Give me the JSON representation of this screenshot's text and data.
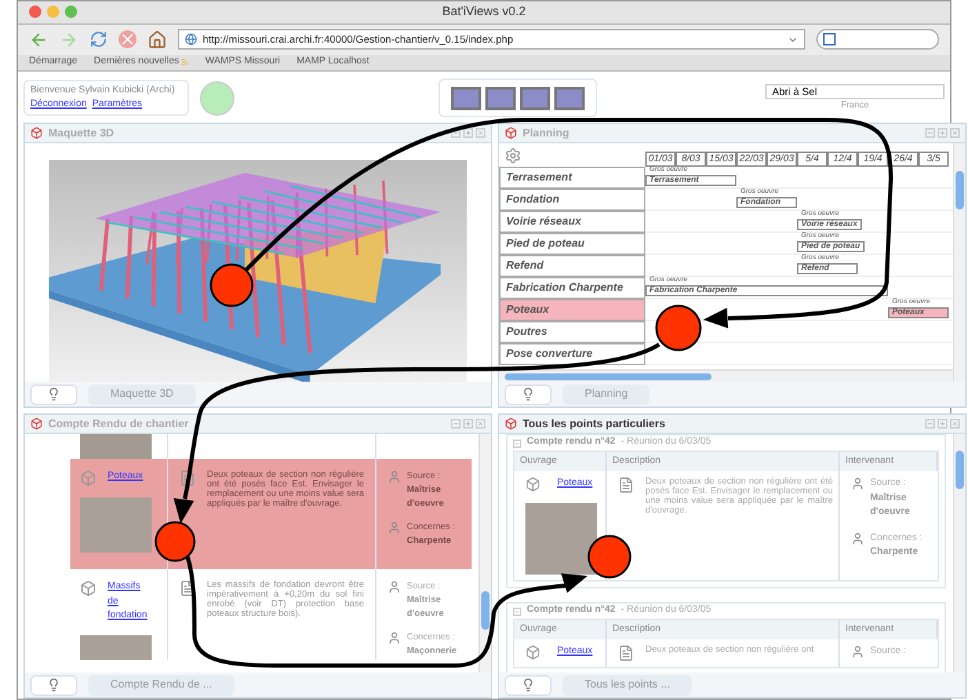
{
  "window": {
    "title": "Bat'iViews v0.2"
  },
  "toolbar": {
    "url": "http://missouri.crai.archi.fr:40000/Gestion-chantier/v_0.15/index.php"
  },
  "bookmarks": [
    {
      "label": "Démarrage",
      "feed": false
    },
    {
      "label": "Dernières nouvelles",
      "feed": true
    },
    {
      "label": "WAMPS Missouri",
      "feed": false
    },
    {
      "label": "MAMP Localhost",
      "feed": false
    }
  ],
  "header": {
    "welcome": "Bienvenue Sylvain Kubicki (Archi)",
    "links": [
      "Déconnexion",
      "Paramètres"
    ],
    "project": "Abri à Sel",
    "country": "France"
  },
  "maquette": {
    "title": "Maquette 3D",
    "tab": "Maquette 3D"
  },
  "planning": {
    "title": "Planning",
    "tab": "Planning",
    "dates": [
      "01/03",
      "8/03",
      "15/03",
      "22/03",
      "29/03",
      "5/4",
      "12/4",
      "19/4",
      "26/4",
      "3/5"
    ],
    "tasks": [
      {
        "label": "Terrasement",
        "selected": false,
        "bar": {
          "group": "Gros oeuvre",
          "label": "Terrasement"
        }
      },
      {
        "label": "Fondation",
        "selected": false,
        "bar": {
          "group": "Gros oeuvre",
          "label": "Fondation"
        }
      },
      {
        "label": "Voirie réseaux",
        "selected": false,
        "bar": {
          "group": "Gros oeuvre",
          "label": "Voirie réseaux"
        }
      },
      {
        "label": "Pied de poteau",
        "selected": false,
        "bar": {
          "group": "Gros oeuvre",
          "label": "Pied de poteau"
        }
      },
      {
        "label": "Refend",
        "selected": false,
        "bar": {
          "group": "Gros oeuvre",
          "label": "Refend"
        }
      },
      {
        "label": "Fabrication Charpente",
        "selected": false,
        "bar": {
          "group": "Gros oeuvre",
          "label": "Fabrication Charpente"
        }
      },
      {
        "label": "Poteaux",
        "selected": true,
        "bar": {
          "group": "Gros oeuvre",
          "label": "Poteaux"
        }
      },
      {
        "label": "Poutres",
        "selected": false
      },
      {
        "label": "Pose converture",
        "selected": false
      }
    ]
  },
  "compte_rendu": {
    "title": "Compte Rendu de chantier",
    "tab": "Compte Rendu de ...",
    "rows": [
      {
        "ouvrage": "Poteaux",
        "description": "Deux poteaux de section non régulière ont été posés face Est. Envisager le remplacement ou une moins value sera appliqués par le maître d'ouvrage.",
        "source_label": "Source :",
        "source": "Maîtrise d'oeuvre",
        "concerne_label": "Concernes :",
        "concerne": "Charpente",
        "selected": true
      },
      {
        "ouvrage": "Massifs de fondation",
        "description": "Les massifs de fondation devront être impérativement à +0,20m du sol fini enrobé (voir DT) protection base poteaux structure bois).",
        "source_label": "Source :",
        "source": "Maîtrise d'oeuvre",
        "concerne_label": "Concernes :",
        "concerne": "Maçonnerie",
        "selected": false
      }
    ]
  },
  "points": {
    "title": "Tous les points particuliers",
    "tab": "Tous les points ...",
    "reports": [
      {
        "heading": "Compte rendu n°42",
        "meeting": "- Réunion du 6/03/05",
        "columns": [
          "Ouvrage",
          "Description",
          "Intervenant"
        ],
        "ouvrage": "Poteaux",
        "description": "Deux poteaux de section non régulière ont été posés face Est. Envisager le remplacement ou une moins value sera appliquée par le maître d'ouvrage.",
        "source_label": "Source :",
        "source": "Maîtrise d'oeuvre",
        "concerne_label": "Concernes :",
        "concerne": "Charpente"
      },
      {
        "heading": "Compte rendu n°42",
        "meeting": "- Réunion du 6/03/05",
        "columns": [
          "Ouvrage",
          "Description",
          "Intervenant"
        ],
        "ouvrage": "Poteaux",
        "description": "Deux poteaux de section non régulière ont",
        "source_label": "Source :"
      }
    ]
  }
}
